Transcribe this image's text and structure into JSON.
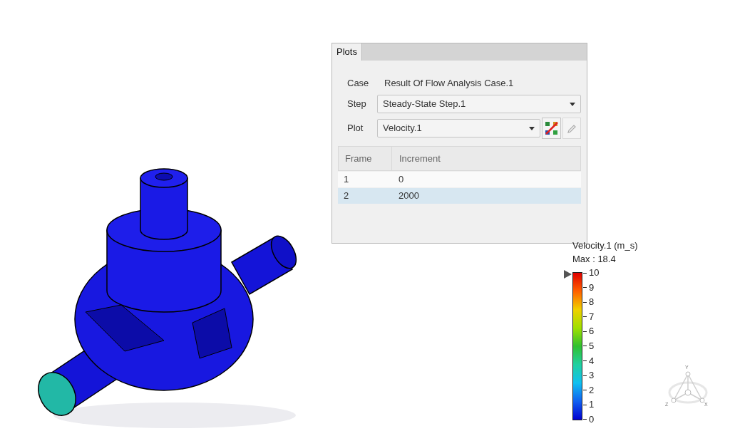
{
  "dialog": {
    "tabs": [
      {
        "label": "Plots",
        "selected": true
      }
    ],
    "case": {
      "label": "Case",
      "value": "Result Of Flow Analysis Case.1"
    },
    "step": {
      "label": "Step",
      "value": "Steady-State Step.1"
    },
    "plot": {
      "label": "Plot",
      "value": "Velocity.1"
    },
    "table": {
      "columns": [
        "Frame",
        "Increment"
      ],
      "rows": [
        {
          "cells": [
            "1",
            "0"
          ],
          "selected": false
        },
        {
          "cells": [
            "2",
            "2000"
          ],
          "selected": true
        }
      ]
    }
  },
  "legend": {
    "title": "Velocity.1 (m_s)",
    "max": "Max : 18.4",
    "ticks": [
      "10",
      "9",
      "8",
      "7",
      "6",
      "5",
      "4",
      "3",
      "2",
      "1",
      "0"
    ]
  },
  "triad": {
    "axes": [
      "Y",
      "Z",
      "X"
    ]
  }
}
